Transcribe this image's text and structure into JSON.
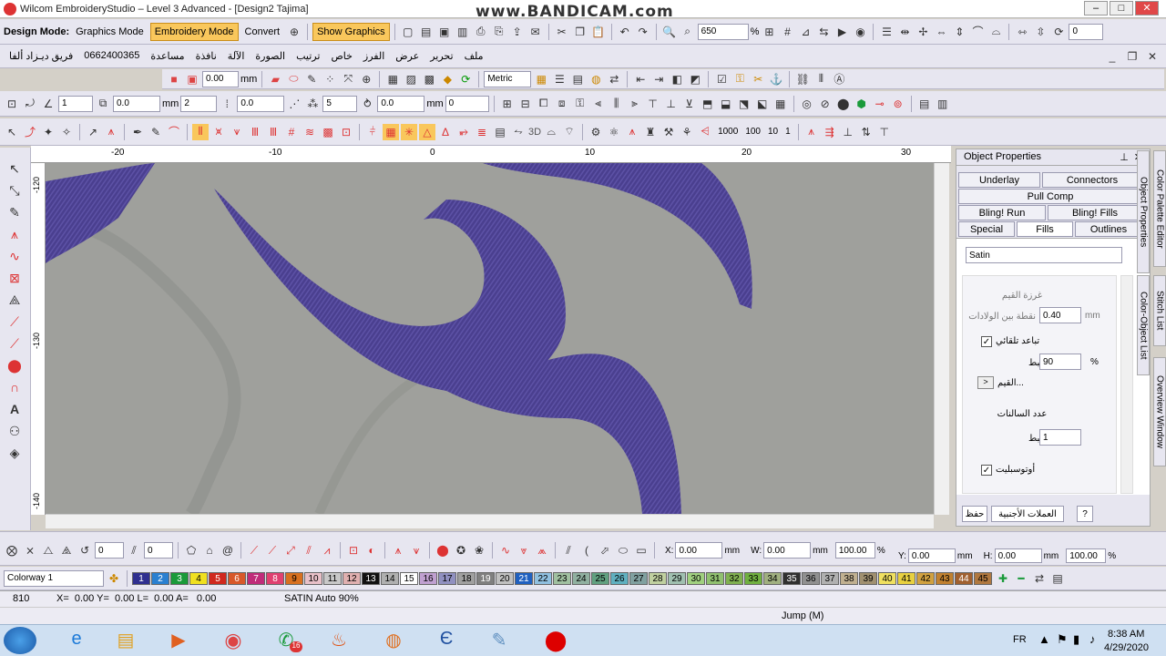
{
  "title": "Wilcom EmbroideryStudio – Level 3 Advanced - [Design2        Tajima]",
  "watermark": "www.BANDICAM.com",
  "window_buttons": [
    "–",
    "□",
    "✕"
  ],
  "toolbar1": {
    "design_mode_label": "Design Mode:",
    "graphics_mode": "Graphics Mode",
    "embroidery_mode": "Embroidery Mode",
    "convert": "Convert",
    "show_graphics": "Show Graphics",
    "zoom_value": "650",
    "zoom_unit": "%",
    "right_value": "0"
  },
  "menu": {
    "items": [
      "ملف",
      "تحرير",
      "عرض",
      "الفرز",
      "خاص",
      "ترتيب",
      "الصورة",
      "الآلة",
      "نافذة",
      "مساعدة",
      "0662400365",
      "فريق ديـزاد ألفا"
    ]
  },
  "toolbar2": {
    "value1": "0.00",
    "unit1": "mm",
    "metric": "Metric"
  },
  "toolbar3": {
    "v1": "1",
    "v2": "0.0",
    "unit": "mm",
    "v3": "2",
    "v4": "0.0",
    "v5": "5",
    "v6": "0.0",
    "unit2": "mm",
    "v7": "0"
  },
  "toolbar4": {
    "counts": [
      "1000",
      "100",
      "10",
      "1"
    ],
    "threed": "3D"
  },
  "ruler": {
    "top": [
      "-20",
      "-10",
      "0",
      "10",
      "20",
      "30"
    ],
    "left": [
      "-120",
      "-130",
      "-140"
    ]
  },
  "panel": {
    "title": "Object Properties",
    "tabs": {
      "underlay": "Underlay",
      "connectors": "Connectors",
      "pull_comp": "Pull Comp",
      "bling_run": "Bling! Run",
      "bling_fills": "Bling! Fills",
      "special": "Special",
      "fills": "Fills",
      "outlines": "Outlines"
    },
    "fill_type": "Satin",
    "section1_title": "غرزة القيم",
    "spacing_label": "نقطة بين الولادات",
    "spacing_value": "0.40",
    "spacing_unit": "mm",
    "auto_spacing_label": "تباعد تلقائي",
    "adjust_label": "ضبط",
    "adjust_value": "90",
    "adjust_unit": "%",
    "values_button": "...القيم",
    "steps_title": "عدد السالنات",
    "steps_adjust_label": "ضبط",
    "steps_value": "1",
    "autosplit_label": "أوتوسبليت",
    "save_button": "حفظ",
    "currencies_button": "العملات الأجنبية",
    "help_button": "?"
  },
  "side_tabs": [
    "Color Palette Editor",
    "Object Properties",
    "Color-Object List",
    "Stitch List",
    "Overview Window"
  ],
  "bottom_toolbar": {
    "v1": "0",
    "v2": "0",
    "x": "0.00",
    "y": "0.00",
    "w": "0.00",
    "h": "0.00",
    "unit": "mm",
    "pw": "100.00",
    "ph": "100.00",
    "pct": "%"
  },
  "colorway": {
    "name": "Colorway 1",
    "swatches": [
      "1",
      "2",
      "3",
      "4",
      "5",
      "6",
      "7",
      "8",
      "9",
      "10",
      "11",
      "12",
      "13",
      "14",
      "15",
      "16",
      "17",
      "18",
      "19",
      "20",
      "21",
      "22",
      "23",
      "24",
      "25",
      "26",
      "27",
      "28",
      "29",
      "30",
      "31",
      "32",
      "33",
      "34",
      "35",
      "36",
      "37",
      "38",
      "39",
      "40",
      "41",
      "42",
      "43",
      "44",
      "45"
    ],
    "colors": [
      "#2f2f8f",
      "#2a7fd0",
      "#1a9a3a",
      "#f0e020",
      "#d0281e",
      "#d8582a",
      "#c02c7a",
      "#e04070",
      "#d87020",
      "#e8c0c8",
      "#c8c8c8",
      "#e0b0b0",
      "#111111",
      "#b0b0b0",
      "#ffffff",
      "#c0a0d0",
      "#9090c0",
      "#a0a0a0",
      "#808080",
      "#c0c0c0",
      "#2060c0",
      "#90c0e0",
      "#a0c0a0",
      "#90b0a0",
      "#60a080",
      "#60b0c0",
      "#80a0a0",
      "#c0d0a0",
      "#a0c0b0",
      "#a0d080",
      "#90c070",
      "#80b050",
      "#70b040",
      "#a0b080",
      "#303030",
      "#909090",
      "#b0b0b0",
      "#c0b090",
      "#a09070",
      "#f0e060",
      "#e8d040",
      "#d0a040",
      "#c08030",
      "#a06030",
      "#b07840"
    ]
  },
  "status": {
    "stitch": "810",
    "coords": "X=  0.00 Y=  0.00 L=  0.00 A=   0.00",
    "info": "SATIN Auto 90%",
    "jump": "Jump (M)"
  },
  "taskbar": {
    "lang": "FR",
    "time": "8:38 AM",
    "date": "4/29/2020",
    "badge": "16"
  }
}
